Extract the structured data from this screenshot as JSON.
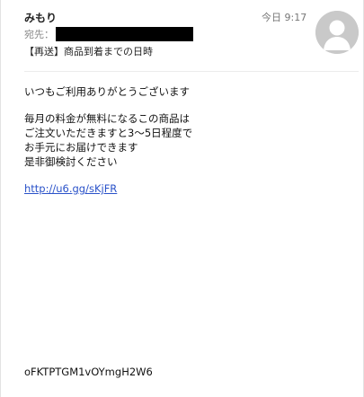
{
  "header": {
    "sender": "みもり",
    "time": "今日 9:17",
    "to_label": "宛先：",
    "subject": "【再送】商品到着までの日時"
  },
  "body": {
    "greeting": "いつもご利用ありがとうございます",
    "lines": [
      "毎月の料金が無料になるこの商品は",
      "ご注文いただきますと3〜5日程度で",
      "お手元にお届けできます",
      "是非御検討ください"
    ],
    "link": "http://u6.gg/sKjFR",
    "code": "oFKTPTGM1vOYmgH2W6"
  },
  "avatar": {
    "icon": "person-silhouette-icon",
    "bg_color": "#c9c9c9"
  }
}
